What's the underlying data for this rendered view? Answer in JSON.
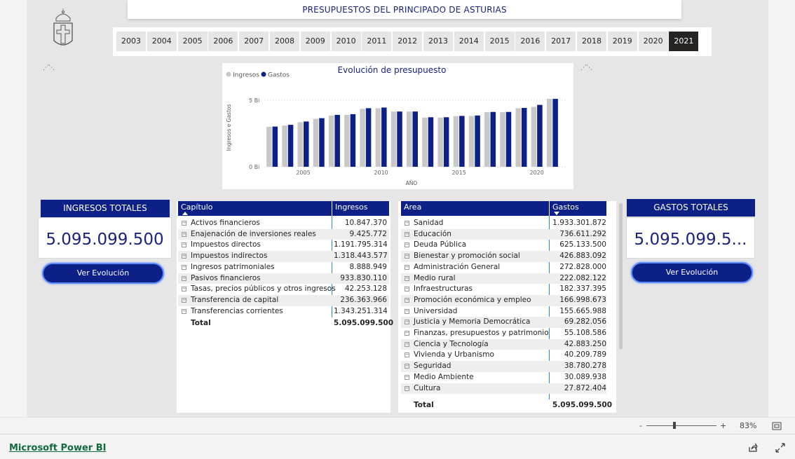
{
  "report": {
    "title": "PRESUPUESTOS DEL PRINCIPADO DE ASTURIAS"
  },
  "years": {
    "items": [
      "2003",
      "2004",
      "2005",
      "2006",
      "2007",
      "2008",
      "2009",
      "2010",
      "2011",
      "2012",
      "2013",
      "2014",
      "2015",
      "2016",
      "2017",
      "2018",
      "2019",
      "2020",
      "2021"
    ],
    "selected": "2021"
  },
  "chart_data": {
    "type": "bar",
    "title": "Evolución de presupuesto",
    "xlabel": "AÑO",
    "ylabel": "Ingresos e Gastos",
    "x": [
      2003,
      2004,
      2005,
      2006,
      2007,
      2008,
      2009,
      2010,
      2011,
      2012,
      2013,
      2014,
      2015,
      2016,
      2017,
      2018,
      2019,
      2020,
      2021
    ],
    "xticks": [
      "2005",
      "2010",
      "2015",
      "2020"
    ],
    "yticks": [
      "0 Bi",
      "5 Bi"
    ],
    "ylim": [
      0,
      5
    ],
    "legend_position": "top-left",
    "grid": true,
    "series": [
      {
        "name": "Ingresos",
        "color": "#c8c8c8",
        "values": [
          3.0,
          3.1,
          3.35,
          3.6,
          3.85,
          3.9,
          4.35,
          4.4,
          4.15,
          4.15,
          3.7,
          3.7,
          3.8,
          3.82,
          4.1,
          4.1,
          4.4,
          4.5,
          5.1
        ]
      },
      {
        "name": "Gastos",
        "color": "#0d2088",
        "values": [
          3.02,
          3.15,
          3.4,
          3.65,
          3.9,
          3.95,
          4.4,
          4.45,
          4.15,
          4.15,
          3.72,
          3.72,
          3.82,
          3.85,
          4.12,
          4.12,
          4.42,
          4.65,
          5.1
        ]
      }
    ]
  },
  "kpi_ingresos": {
    "title": "INGRESOS TOTALES",
    "value": "5.095.099.500",
    "button": "Ver Evolución"
  },
  "kpi_gastos": {
    "title": "GASTOS TOTALES",
    "value": "5.095.099.5...",
    "button": "Ver Evolución"
  },
  "ingresos_table": {
    "col1": "Capítulo",
    "col2": "Ingresos",
    "rows": [
      {
        "label": "Activos financieros",
        "value": "10.847.370"
      },
      {
        "label": "Enajenación de inversiones reales",
        "value": "9.425.772"
      },
      {
        "label": "Impuestos directos",
        "value": "1.191.795.314"
      },
      {
        "label": "Impuestos indirectos",
        "value": "1.318.443.577"
      },
      {
        "label": "Ingresos patrimoniales",
        "value": "8.888.949"
      },
      {
        "label": "Pasivos financieros",
        "value": "933.830.110"
      },
      {
        "label": "Tasas, precios públicos y otros ingresos",
        "value": "42.253.128"
      },
      {
        "label": "Transferencia de capital",
        "value": "236.363.966"
      },
      {
        "label": "Transferencias corrientes",
        "value": "1.343.251.314"
      }
    ],
    "total_label": "Total",
    "total_value": "5.095.099.500"
  },
  "gastos_table": {
    "col1": "Area",
    "col2": "Gastos",
    "rows": [
      {
        "label": "Sanidad",
        "value": "1.933.301.872"
      },
      {
        "label": "Educación",
        "value": "736.611.292"
      },
      {
        "label": "Deuda Pública",
        "value": "625.133.500"
      },
      {
        "label": "Bienestar y promoción social",
        "value": "426.883.092"
      },
      {
        "label": "Administración General",
        "value": "272.828.000"
      },
      {
        "label": "Medio rural",
        "value": "222.082.122"
      },
      {
        "label": "Infraestructuras",
        "value": "182.337.395"
      },
      {
        "label": "Promoción económica y empleo",
        "value": "166.998.673"
      },
      {
        "label": "Universidad",
        "value": "155.665.988"
      },
      {
        "label": "Justicia y Memoria Democrática",
        "value": "69.282.056"
      },
      {
        "label": "Finanzas, presupuestos y patrimonio",
        "value": "55.108.586"
      },
      {
        "label": "Ciencia y Tecnología",
        "value": "42.883.250"
      },
      {
        "label": "Vivienda y Urbanismo",
        "value": "40.209.789"
      },
      {
        "label": "Seguridad",
        "value": "38.780.278"
      },
      {
        "label": "Medio Ambiente",
        "value": "30.089.938"
      },
      {
        "label": "Cultura",
        "value": "27.872.404"
      }
    ],
    "total_label": "Total",
    "total_value": "5.095.099.500"
  },
  "status": {
    "zoom": "83%",
    "zoom_minus": "-",
    "zoom_plus": "+"
  },
  "footer": {
    "link": "Microsoft Power BI"
  }
}
